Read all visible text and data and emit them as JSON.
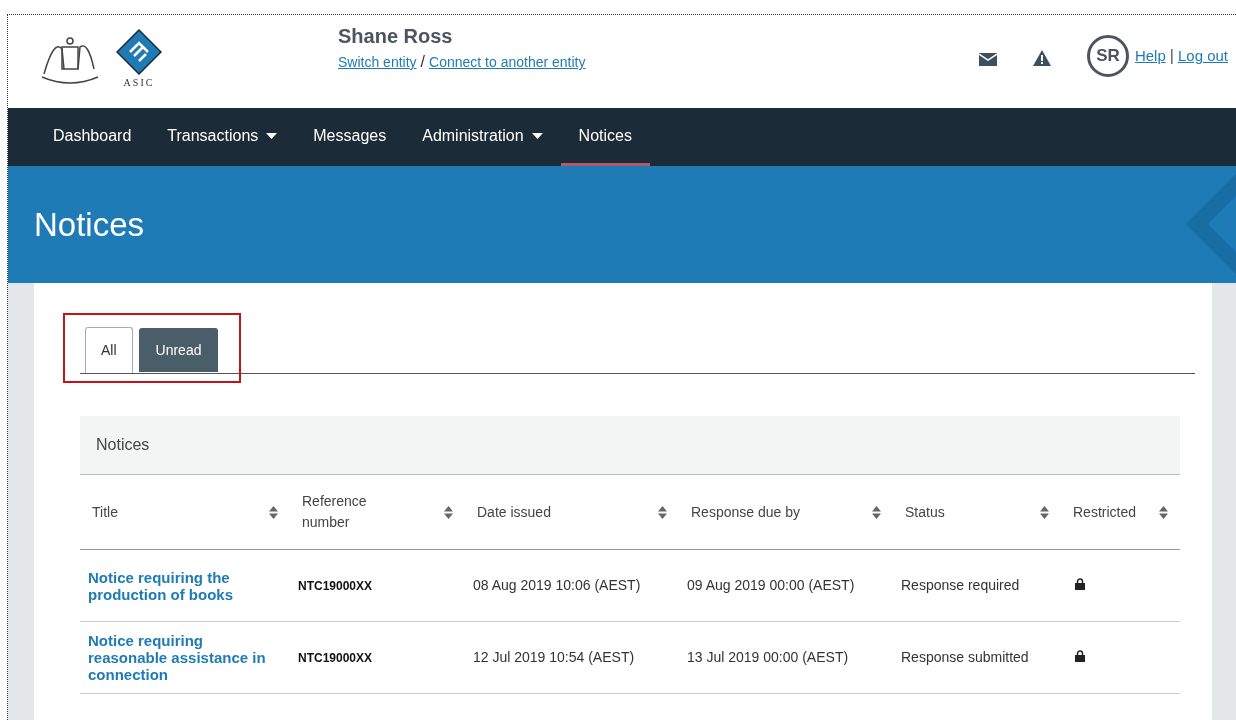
{
  "header": {
    "logo_text": "ASIC",
    "user_name": "Shane Ross",
    "links": [
      "Switch entity",
      "Connect to another entity"
    ],
    "link_separator": "/",
    "avatar_initials": "SR",
    "help": "Help",
    "help_separator": "|",
    "logout": "Log out"
  },
  "nav": [
    {
      "label": "Dashboard",
      "dropdown": false,
      "selected": false
    },
    {
      "label": "Transactions",
      "dropdown": true,
      "selected": false
    },
    {
      "label": "Messages",
      "dropdown": false,
      "selected": false
    },
    {
      "label": "Administration",
      "dropdown": true,
      "selected": false
    },
    {
      "label": "Notices",
      "dropdown": false,
      "selected": true
    }
  ],
  "page_title": "Notices",
  "tabs": [
    {
      "label": "All",
      "selected": true
    },
    {
      "label": "Unread",
      "selected": false
    }
  ],
  "card_title": "Notices",
  "table": {
    "columns": [
      "Title",
      "Reference number",
      "Date issued",
      "Response due by",
      "Status",
      "Restricted"
    ],
    "rows": [
      {
        "title": "Notice requiring the production of books",
        "reference": "NTC19000XX",
        "date_issued": "08 Aug 2019 10:06 (AEST)",
        "response_due": "09 Aug 2019 00:00 (AEST)",
        "status": "Response required",
        "restricted": true
      },
      {
        "title": "Notice requiring reasonable assistance in connection",
        "reference": "NTC19000XX",
        "date_issued": "12 Jul 2019 10:54 (AEST)",
        "response_due": "13 Jul 2019 00:00 (AEST)",
        "status": "Response submitted",
        "restricted": true
      }
    ]
  }
}
